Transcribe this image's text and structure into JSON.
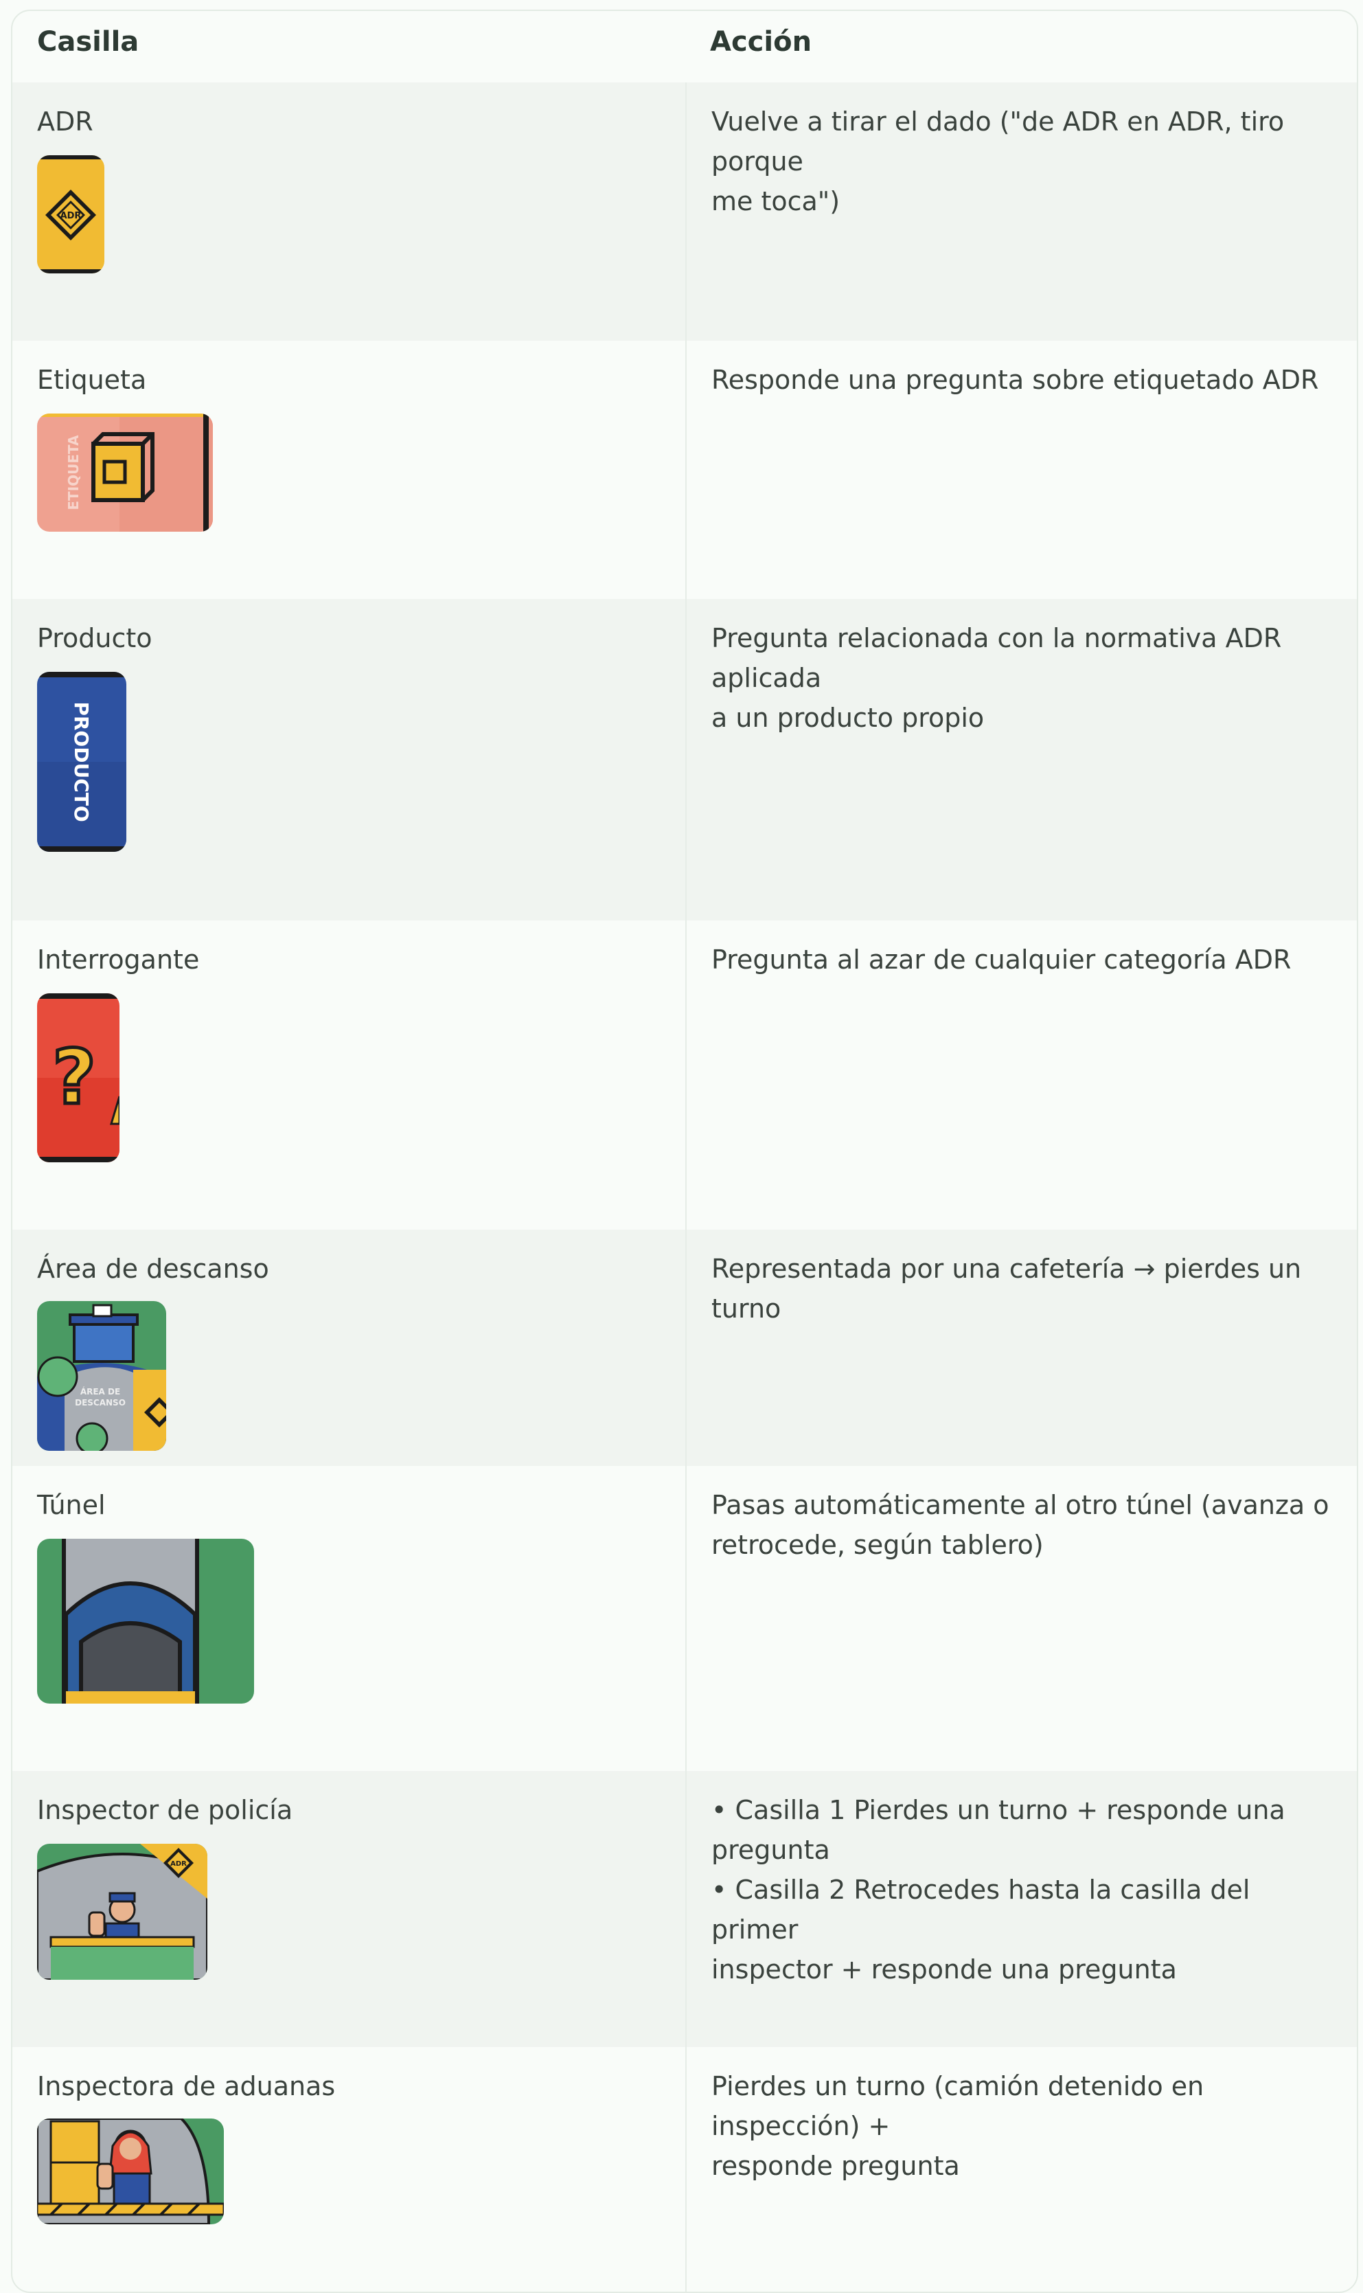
{
  "header": {
    "col_casilla": "Casilla",
    "col_accion": "Acción"
  },
  "rows": [
    {
      "casilla": "ADR",
      "accion": "Vuelve a tirar el dado (\"de ADR en ADR, tiro porque\nme toca\")",
      "icon": "adr-sign-icon"
    },
    {
      "casilla": "Etiqueta",
      "accion": "Responde una pregunta sobre etiquetado ADR",
      "icon": "label-box-icon",
      "tile_text": "ETIQUETA"
    },
    {
      "casilla": "Producto",
      "accion": "Pregunta relacionada con la normativa ADR aplicada\na un producto propio",
      "icon": "product-icon",
      "tile_text": "PRODUCTO"
    },
    {
      "casilla": "Interrogante",
      "accion": "Pregunta al azar de cualquier categoría ADR",
      "icon": "question-mark-icon"
    },
    {
      "casilla": "Área de descanso",
      "accion": "Representada por una cafetería  → pierdes un turno",
      "icon": "rest-area-icon",
      "tile_text": "ÁREA DE DESCANSO"
    },
    {
      "casilla": "Túnel",
      "accion": "Pasas automáticamente al otro túnel (avanza o\nretrocede, según tablero)",
      "icon": "tunnel-icon"
    },
    {
      "casilla": "Inspector de policía",
      "accion": "• Casilla 1 Pierdes un turno + responde una pregunta\n• Casilla 2 Retrocedes hasta la casilla del primer\ninspector + responde una pregunta",
      "icon": "police-inspector-icon"
    },
    {
      "casilla": "Inspectora de aduanas",
      "accion": "Pierdes un turno (camión detenido en inspección) +\nresponde pregunta",
      "icon": "customs-inspector-icon"
    }
  ]
}
